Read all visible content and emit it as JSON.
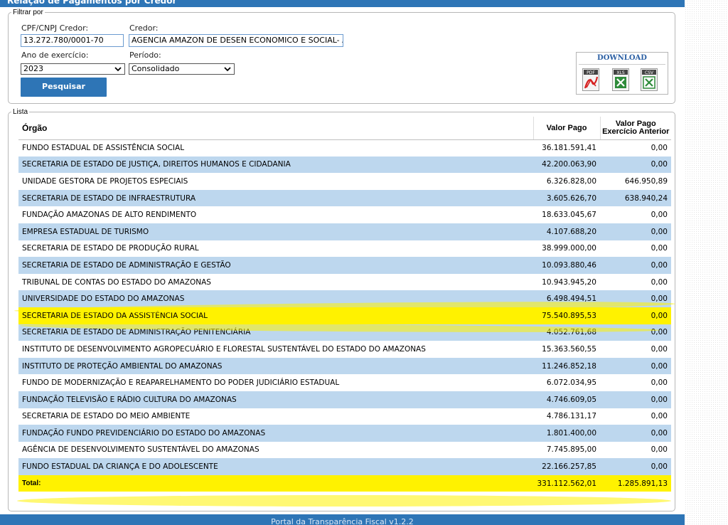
{
  "header": {
    "title": "Relação de Pagamentos por Credor"
  },
  "filter": {
    "legend": "Filtrar por",
    "cpf_label": "CPF/CNPJ Credor:",
    "cpf_value": "13.272.780/0001-70",
    "credor_label": "Credor:",
    "credor_value": "AGENCIA AMAZON DE DESEN ECONOMICO E SOCIAL- A",
    "ano_label": "Ano de exercício:",
    "ano_value": "2023",
    "periodo_label": "Período:",
    "periodo_value": "Consolidado",
    "search_label": "Pesquisar"
  },
  "download": {
    "title": "DOWNLOAD",
    "pdf_label": "PDF",
    "xls_label": "XLS",
    "csv_label": "CSV"
  },
  "lista": {
    "legend": "Lista",
    "columns": {
      "orgao": "Órgão",
      "valor_pago": "Valor Pago",
      "valor_pago_ant_line1": "Valor Pago",
      "valor_pago_ant_line2": "Exercício Anterior"
    },
    "rows": [
      {
        "orgao": "FUNDO ESTADUAL DE ASSISTÊNCIA SOCIAL",
        "valor": "36.181.591,41",
        "anterior": "0,00"
      },
      {
        "orgao": "SECRETARIA DE ESTADO DE JUSTIÇA, DIREITOS HUMANOS E CIDADANIA",
        "valor": "42.200.063,90",
        "anterior": "0,00"
      },
      {
        "orgao": "UNIDADE GESTORA DE PROJETOS ESPECIAIS",
        "valor": "6.326.828,00",
        "anterior": "646.950,89"
      },
      {
        "orgao": "SECRETARIA DE ESTADO DE INFRAESTRUTURA",
        "valor": "3.605.626,70",
        "anterior": "638.940,24"
      },
      {
        "orgao": "FUNDAÇÃO AMAZONAS DE ALTO RENDIMENTO",
        "valor": "18.633.045,67",
        "anterior": "0,00"
      },
      {
        "orgao": "EMPRESA ESTADUAL DE TURISMO",
        "valor": "4.107.688,20",
        "anterior": "0,00"
      },
      {
        "orgao": "SECRETARIA DE ESTADO DE PRODUÇÃO RURAL",
        "valor": "38.999.000,00",
        "anterior": "0,00"
      },
      {
        "orgao": "SECRETARIA DE ESTADO DE ADMINISTRAÇÃO E GESTÃO",
        "valor": "10.093.880,46",
        "anterior": "0,00"
      },
      {
        "orgao": "TRIBUNAL DE CONTAS DO ESTADO DO AMAZONAS",
        "valor": "10.943.945,20",
        "anterior": "0,00"
      },
      {
        "orgao": "UNIVERSIDADE DO ESTADO DO AMAZONAS",
        "valor": "6.498.494,51",
        "anterior": "0,00"
      },
      {
        "orgao": "SECRETARIA DE ESTADO DA ASSISTÊNCIA SOCIAL",
        "valor": "75.540.895,53",
        "anterior": "0,00"
      },
      {
        "orgao": "SECRETARIA DE ESTADO DE ADMINISTRAÇÃO PENITENCIÁRIA",
        "valor": "4.052.761,68",
        "anterior": "0,00"
      },
      {
        "orgao": "INSTITUTO DE DESENVOLVIMENTO AGROPECUÁRIO E FLORESTAL SUSTENTÁVEL DO ESTADO DO AMAZONAS",
        "valor": "15.363.560,55",
        "anterior": "0,00"
      },
      {
        "orgao": "INSTITUTO DE PROTEÇÃO AMBIENTAL DO AMAZONAS",
        "valor": "11.246.852,18",
        "anterior": "0,00"
      },
      {
        "orgao": "FUNDO DE MODERNIZAÇÃO E REAPARELHAMENTO DO PODER JUDICIÁRIO ESTADUAL",
        "valor": "6.072.034,95",
        "anterior": "0,00"
      },
      {
        "orgao": "FUNDAÇÃO TELEVISÃO E RÁDIO CULTURA DO AMAZONAS",
        "valor": "4.746.609,05",
        "anterior": "0,00"
      },
      {
        "orgao": "SECRETARIA DE ESTADO DO MEIO AMBIENTE",
        "valor": "4.786.131,17",
        "anterior": "0,00"
      },
      {
        "orgao": "FUNDAÇÃO FUNDO PREVIDENCIÁRIO DO ESTADO DO AMAZONAS",
        "valor": "1.801.400,00",
        "anterior": "0,00"
      },
      {
        "orgao": "AGÊNCIA DE DESENVOLVIMENTO SUSTENTÁVEL DO AMAZONAS",
        "valor": "7.745.895,00",
        "anterior": "0,00"
      },
      {
        "orgao": "FUNDO ESTADUAL DA CRIANÇA E DO ADOLESCENTE",
        "valor": "22.166.257,85",
        "anterior": "0,00"
      }
    ],
    "highlighted_row_index": 10,
    "total": {
      "label": "Total:",
      "valor": "331.112.562,01",
      "anterior": "1.285.891,13"
    }
  },
  "footer": {
    "text": "Portal da Transparência Fiscal v1.2.2"
  },
  "colors": {
    "header_blue": "#2e75b6",
    "row_stripe": "#bdd7ee",
    "highlight": "#fff200"
  }
}
